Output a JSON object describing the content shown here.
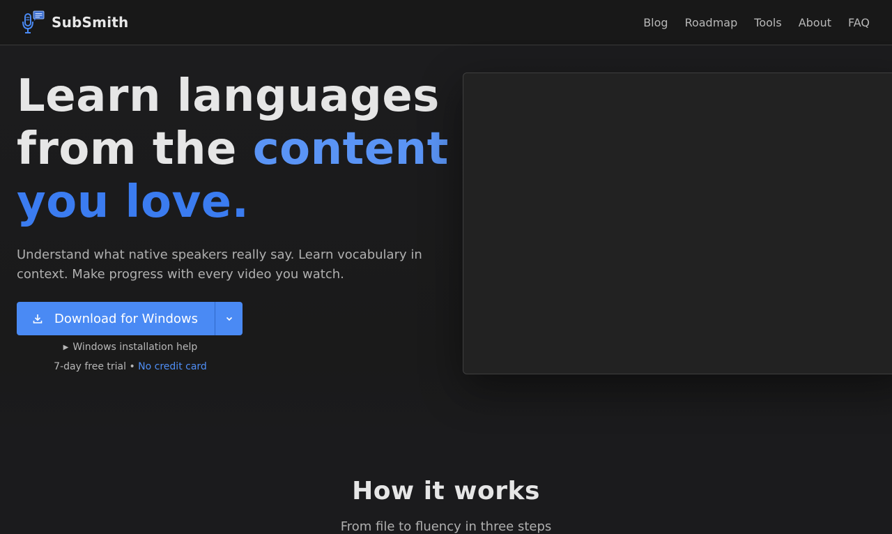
{
  "nav": {
    "brand": "SubSmith",
    "links": [
      "Blog",
      "Roadmap",
      "Tools",
      "About",
      "FAQ"
    ]
  },
  "hero": {
    "title_part1": "Learn languages from the ",
    "title_part2": "content",
    "title_part3": "you love.",
    "subtitle": "Understand what native speakers really say. Learn vocabulary in context. Make progress with every video you watch.",
    "download_label": "Download for Windows",
    "install_help": "Windows installation help",
    "trial_text": "7-day free trial",
    "trial_separator": " • ",
    "trial_link": "No credit card"
  },
  "how_it_works": {
    "title": "How it works",
    "subtitle": "From file to fluency in three steps"
  },
  "colors": {
    "accent": "#4a8af4",
    "accent_text": "#5a94f5",
    "background": "#1b1b1d"
  },
  "icons": {
    "logo": "microphone-subtitle-logo",
    "download": "download-icon",
    "dropdown": "chevron-down-icon",
    "disclosure": "triangle-right-icon"
  }
}
